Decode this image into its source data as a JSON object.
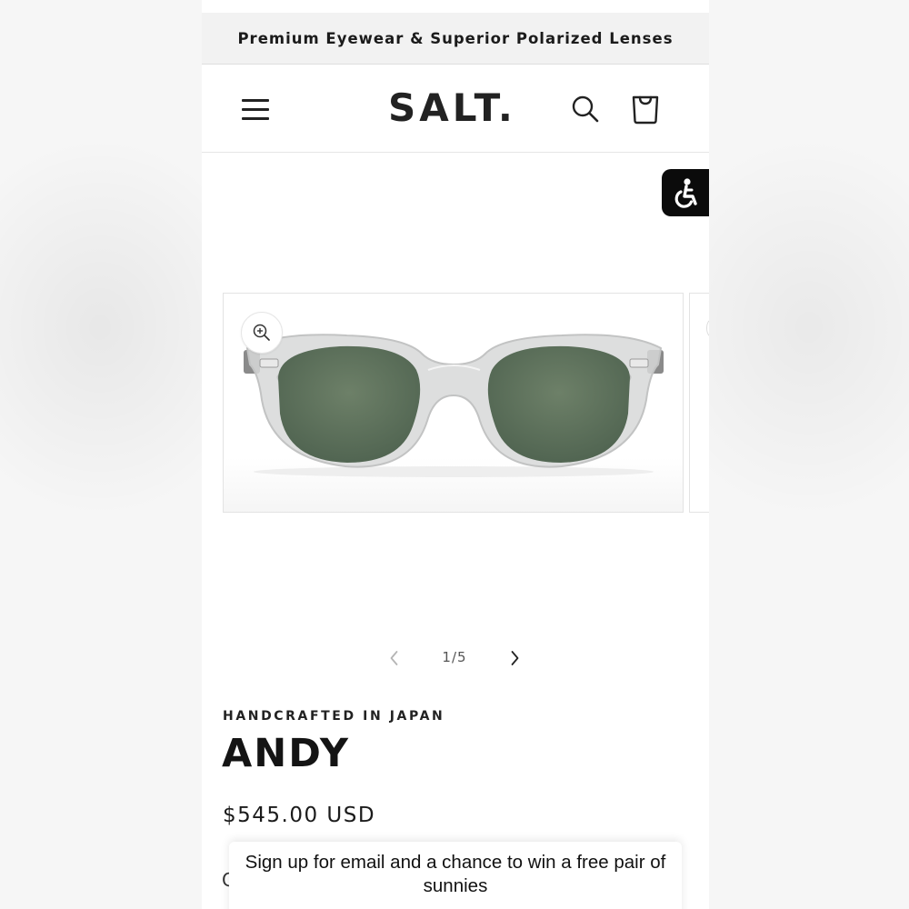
{
  "announcement": {
    "text": "Premium Eyewear & Superior Polarized Lenses"
  },
  "header": {
    "logo": "SALT.",
    "menu_icon": "hamburger-menu-icon",
    "search_icon": "search-icon",
    "cart_icon": "shopping-bag-icon"
  },
  "accessibility": {
    "icon": "accessibility-wheelchair-icon"
  },
  "gallery": {
    "zoom_icon": "zoom-in-icon",
    "prev_icon": "chevron-left-icon",
    "next_icon": "chevron-right-icon",
    "counter": "1/5",
    "current_slide": 1,
    "total_slides": 5
  },
  "product": {
    "vendor": "HANDCRAFTED IN JAPAN",
    "title": "ANDY",
    "price": "$545.00 USD",
    "partial_text": "C"
  },
  "popup": {
    "text": "Sign up for email and a chance to win a free pair of sunnies"
  },
  "colors": {
    "announcement_bg": "#f2f2f2",
    "text": "#1b1b1b",
    "lens": "#5f7361",
    "frame": "#cfd0d0",
    "a11y_bg": "#0b0b0b"
  }
}
